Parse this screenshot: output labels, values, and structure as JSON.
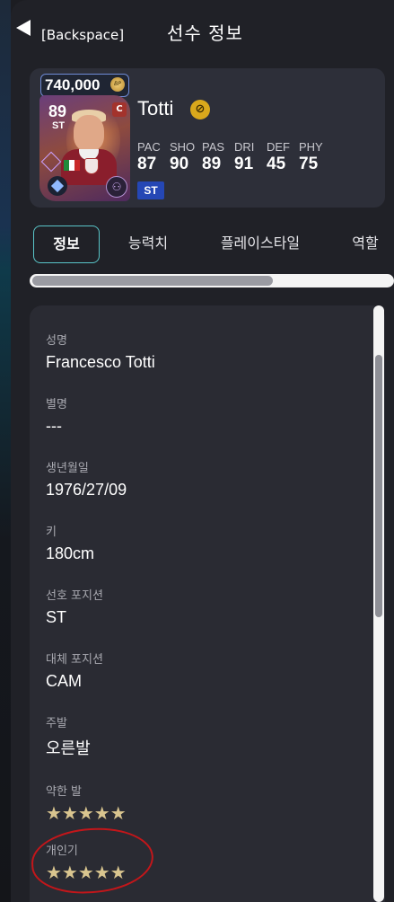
{
  "header": {
    "back_label": "[Backspace]",
    "title": "선수 정보"
  },
  "player_card": {
    "price": "740,000",
    "coin_label": "BP",
    "ovr": "89",
    "card_position": "ST",
    "season_badge": "C",
    "name": "Totti",
    "trait_icon": "trait-badge-icon",
    "stats": [
      {
        "name": "PAC",
        "value": "87"
      },
      {
        "name": "SHO",
        "value": "90"
      },
      {
        "name": "PAS",
        "value": "89"
      },
      {
        "name": "DRI",
        "value": "91"
      },
      {
        "name": "DEF",
        "value": "45"
      },
      {
        "name": "PHY",
        "value": "75"
      }
    ],
    "position_badge": "ST",
    "colors": {
      "position_badge": "#2547b5",
      "trait": "#d9a81c",
      "price_border": "#6f8bd6"
    }
  },
  "tabs": [
    {
      "label": "정보",
      "active": true
    },
    {
      "label": "능력치",
      "active": false
    },
    {
      "label": "플레이스타일",
      "active": false
    },
    {
      "label": "역할",
      "active": false
    }
  ],
  "info": {
    "fields": [
      {
        "label": "성명",
        "value": "Francesco Totti"
      },
      {
        "label": "별명",
        "value": "---"
      },
      {
        "label": "생년월일",
        "value": "1976/27/09"
      },
      {
        "label": "키",
        "value": "180cm"
      },
      {
        "label": "선호 포지션",
        "value": "ST"
      },
      {
        "label": "대체 포지션",
        "value": "CAM"
      },
      {
        "label": "주발",
        "value": "오른발"
      }
    ],
    "weak_foot": {
      "label": "약한 발",
      "stars": "★★★★★",
      "rating": 5
    },
    "skill_moves": {
      "label": "개인기",
      "stars": "★★★★★",
      "rating": 5
    }
  },
  "annotation": {
    "color": "#c3161a"
  }
}
